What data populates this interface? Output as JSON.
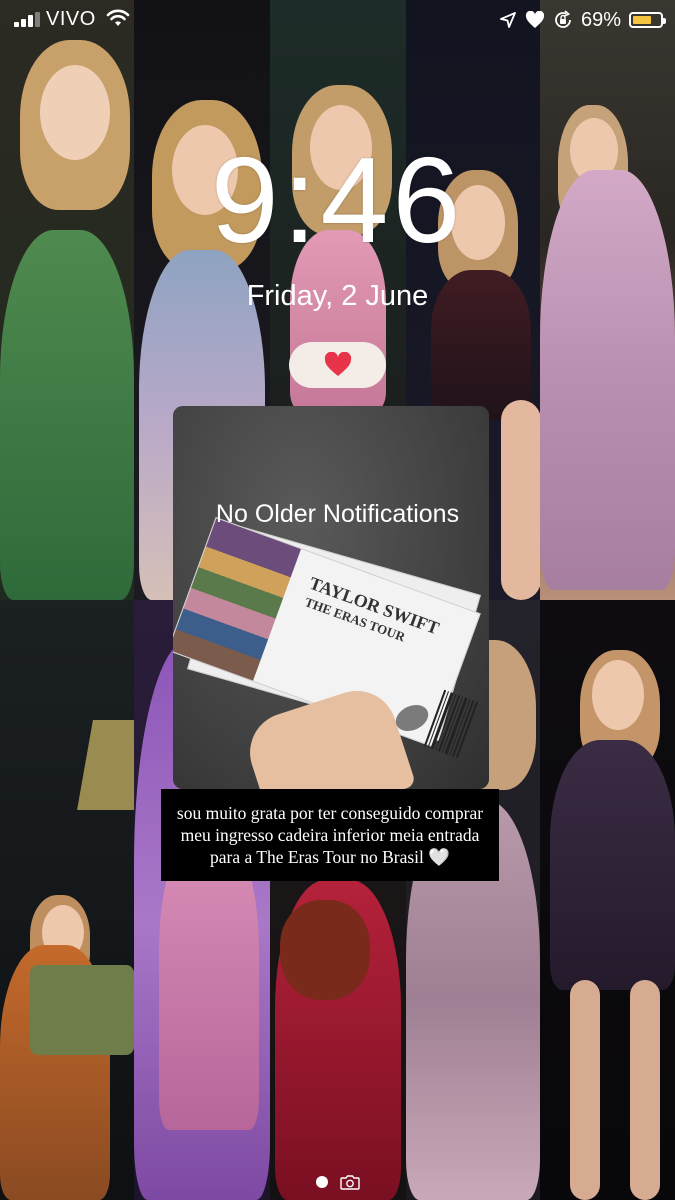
{
  "status_bar": {
    "carrier": "VIVO",
    "battery_percent": "69%",
    "battery_level": 0.69,
    "icons": [
      "signal-icon",
      "wifi-icon",
      "location-arrow-icon",
      "heart-icon",
      "rotation-lock-icon",
      "battery-icon"
    ]
  },
  "lock_screen": {
    "time": "9:46",
    "date": "Friday, 2 June",
    "widget_icon": "heart-icon",
    "widget_color": "#e8344b"
  },
  "notification_center": {
    "empty_text": "No Older Notifications"
  },
  "story_card": {
    "caption": "sou muito grata por ter conseguido comprar meu ingresso cadeira inferior meia entrada para a The Eras Tour no Brasil 🤍",
    "ticket_title": "TAYLOR SWIFT",
    "ticket_subtitle": "THE ERAS TOUR"
  },
  "page_indicator": {
    "icons": [
      "page-dot",
      "camera-icon"
    ]
  }
}
